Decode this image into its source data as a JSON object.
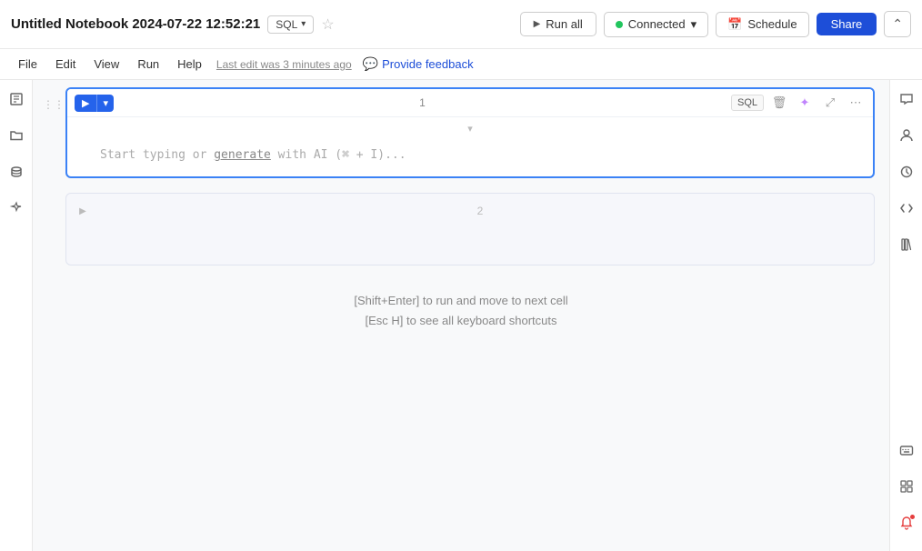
{
  "header": {
    "title": "Untitled Notebook 2024-07-22 12:52:21",
    "sql_badge": "SQL",
    "run_all_label": "Run all",
    "connected_label": "Connected",
    "schedule_label": "Schedule",
    "share_label": "Share",
    "collapse_label": "⌃",
    "last_edit": "Last edit was 3 minutes ago",
    "feedback_label": "Provide feedback"
  },
  "menu": {
    "items": [
      "File",
      "Edit",
      "View",
      "Run",
      "Help"
    ]
  },
  "cells": [
    {
      "id": 1,
      "number": "1",
      "type": "SQL",
      "placeholder": "Start typing or generate with AI (⌘ + I)...",
      "generate_text": "generate",
      "active": true
    },
    {
      "id": 2,
      "number": "2",
      "type": "",
      "placeholder": "",
      "active": false
    }
  ],
  "hints": {
    "line1": "[Shift+Enter] to run and move to next cell",
    "line2": "[Esc H] to see all keyboard shortcuts"
  },
  "sidebar_left": {
    "icons": [
      {
        "name": "notebook-icon",
        "symbol": "▦",
        "active": false
      },
      {
        "name": "folder-icon",
        "symbol": "🗀",
        "active": false
      },
      {
        "name": "database-icon",
        "symbol": "⊛",
        "active": false
      },
      {
        "name": "ai-icon",
        "symbol": "✦",
        "active": false
      }
    ]
  },
  "sidebar_right": {
    "top_icons": [
      {
        "name": "comment-icon",
        "symbol": "💬"
      },
      {
        "name": "user-icon",
        "symbol": "👤"
      },
      {
        "name": "history-icon",
        "symbol": "🕐"
      },
      {
        "name": "code-icon",
        "symbol": "⟨⟩"
      },
      {
        "name": "library-icon",
        "symbol": "▮▮"
      }
    ],
    "bottom_icons": [
      {
        "name": "keyboard-icon",
        "symbol": "⌘"
      },
      {
        "name": "grid-icon",
        "symbol": "⊞"
      },
      {
        "name": "notification-icon",
        "symbol": "🔔",
        "badge": true
      }
    ]
  }
}
